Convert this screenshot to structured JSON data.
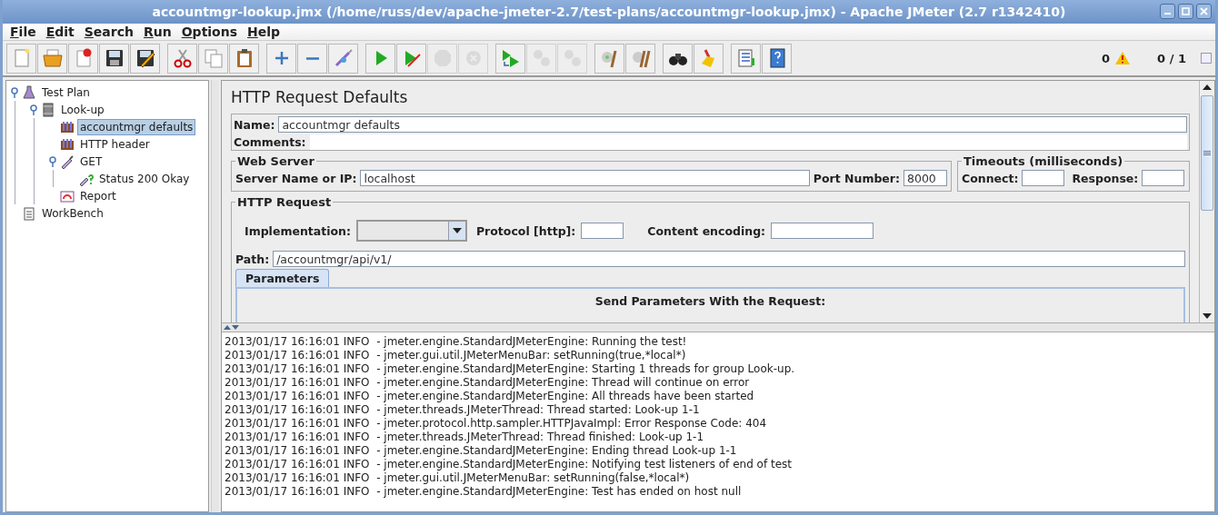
{
  "window": {
    "title": "accountmgr-lookup.jmx (/home/russ/dev/apache-jmeter-2.7/test-plans/accountmgr-lookup.jmx) - Apache JMeter (2.7 r1342410)"
  },
  "menu": [
    "File",
    "Edit",
    "Search",
    "Run",
    "Options",
    "Help"
  ],
  "toolbar": [
    [
      {
        "kind": "new",
        "disabled": false
      },
      {
        "kind": "open",
        "disabled": false
      },
      {
        "kind": "close",
        "disabled": false
      },
      {
        "kind": "save",
        "disabled": false
      },
      {
        "kind": "save-as",
        "disabled": false
      }
    ],
    [
      {
        "kind": "cut",
        "disabled": false
      },
      {
        "kind": "copy",
        "disabled": false
      },
      {
        "kind": "paste",
        "disabled": false
      }
    ],
    [
      {
        "kind": "expand",
        "disabled": false
      },
      {
        "kind": "collapse",
        "disabled": false
      },
      {
        "kind": "toggle",
        "disabled": false
      }
    ],
    [
      {
        "kind": "start",
        "disabled": false
      },
      {
        "kind": "start-no-pause",
        "disabled": false
      },
      {
        "kind": "stop",
        "disabled": true
      },
      {
        "kind": "shutdown",
        "disabled": true
      }
    ],
    [
      {
        "kind": "remote-start",
        "disabled": false
      },
      {
        "kind": "remote-stop",
        "disabled": true
      },
      {
        "kind": "remote-shutdown",
        "disabled": true
      }
    ],
    [
      {
        "kind": "clear",
        "disabled": false
      },
      {
        "kind": "clear-all",
        "disabled": false
      }
    ],
    [
      {
        "kind": "search",
        "disabled": false
      },
      {
        "kind": "reset-search",
        "disabled": false
      }
    ],
    [
      {
        "kind": "functions",
        "disabled": false
      },
      {
        "kind": "help",
        "disabled": false
      }
    ]
  ],
  "status": {
    "errors": "0",
    "threads": "0 / 1"
  },
  "tree": [
    {
      "label": "Test Plan",
      "kind": "plan",
      "selected": false,
      "expanded": true,
      "children": [
        {
          "label": "Look-up",
          "kind": "group",
          "selected": false,
          "expanded": true,
          "children": [
            {
              "label": "accountmgr defaults",
              "kind": "config",
              "selected": true
            },
            {
              "label": "HTTP header",
              "kind": "config",
              "selected": false
            },
            {
              "label": "GET",
              "kind": "sampler",
              "selected": false,
              "expanded": true,
              "children": [
                {
                  "label": "Status 200 Okay",
                  "kind": "assertion",
                  "selected": false
                }
              ]
            },
            {
              "label": "Report",
              "kind": "listener",
              "selected": false
            }
          ]
        }
      ]
    },
    {
      "label": "WorkBench",
      "kind": "workbench",
      "selected": false
    }
  ],
  "panel": {
    "title": "HTTP Request Defaults",
    "name_label": "Name:",
    "name_value": "accountmgr defaults",
    "comments_label": "Comments:",
    "web_server": {
      "legend": "Web Server",
      "server_label": "Server Name or IP:",
      "server_value": "localhost",
      "port_label": "Port Number:",
      "port_value": "8000"
    },
    "timeouts": {
      "legend": "Timeouts (milliseconds)",
      "connect_label": "Connect:",
      "response_label": "Response:"
    },
    "http_request": {
      "legend": "HTTP Request",
      "implementation_label": "Implementation:",
      "protocol_label": "Protocol [http]:",
      "encoding_label": "Content encoding:",
      "path_label": "Path:",
      "path_value": "/accountmgr/api/v1/",
      "tabs": [
        {
          "label": "Parameters",
          "selected": true
        }
      ],
      "table_title": "Send Parameters With the Request:"
    }
  },
  "log": [
    "2013/01/17 16:16:01 INFO  - jmeter.engine.StandardJMeterEngine: Running the test!",
    "2013/01/17 16:16:01 INFO  - jmeter.gui.util.JMeterMenuBar: setRunning(true,*local*)",
    "2013/01/17 16:16:01 INFO  - jmeter.engine.StandardJMeterEngine: Starting 1 threads for group Look-up.",
    "2013/01/17 16:16:01 INFO  - jmeter.engine.StandardJMeterEngine: Thread will continue on error",
    "2013/01/17 16:16:01 INFO  - jmeter.engine.StandardJMeterEngine: All threads have been started",
    "2013/01/17 16:16:01 INFO  - jmeter.threads.JMeterThread: Thread started: Look-up 1-1",
    "2013/01/17 16:16:01 INFO  - jmeter.protocol.http.sampler.HTTPJavaImpl: Error Response Code: 404",
    "2013/01/17 16:16:01 INFO  - jmeter.threads.JMeterThread: Thread finished: Look-up 1-1",
    "2013/01/17 16:16:01 INFO  - jmeter.engine.StandardJMeterEngine: Ending thread Look-up 1-1",
    "2013/01/17 16:16:01 INFO  - jmeter.engine.StandardJMeterEngine: Notifying test listeners of end of test",
    "2013/01/17 16:16:01 INFO  - jmeter.gui.util.JMeterMenuBar: setRunning(false,*local*)",
    "2013/01/17 16:16:01 INFO  - jmeter.engine.StandardJMeterEngine: Test has ended on host null"
  ]
}
